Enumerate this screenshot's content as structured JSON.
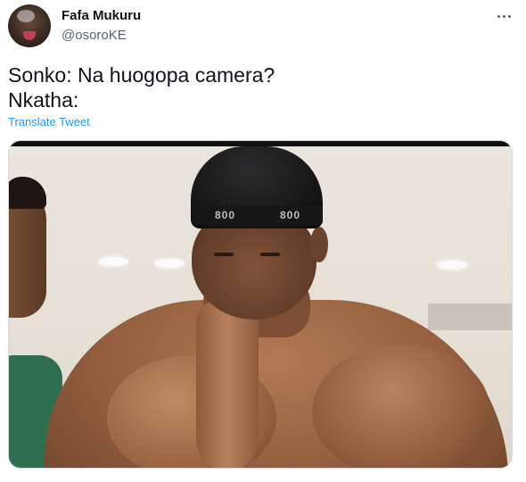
{
  "tweet": {
    "author": {
      "display_name": "Fafa Mukuru",
      "handle": "@osoroKE",
      "avatar_icon": "profile-photo"
    },
    "more_icon": "more-options-icon",
    "text_lines": [
      "Sonko: Na huogopa camera?",
      "Nkatha:"
    ],
    "translate_label": "Translate Tweet",
    "media": {
      "type": "photo",
      "band_text_left": "800",
      "band_text_right": "800"
    }
  },
  "colors": {
    "text_primary": "#0f1419",
    "text_secondary": "#536471",
    "link": "#1d9bf0",
    "border": "#cfd9de"
  }
}
